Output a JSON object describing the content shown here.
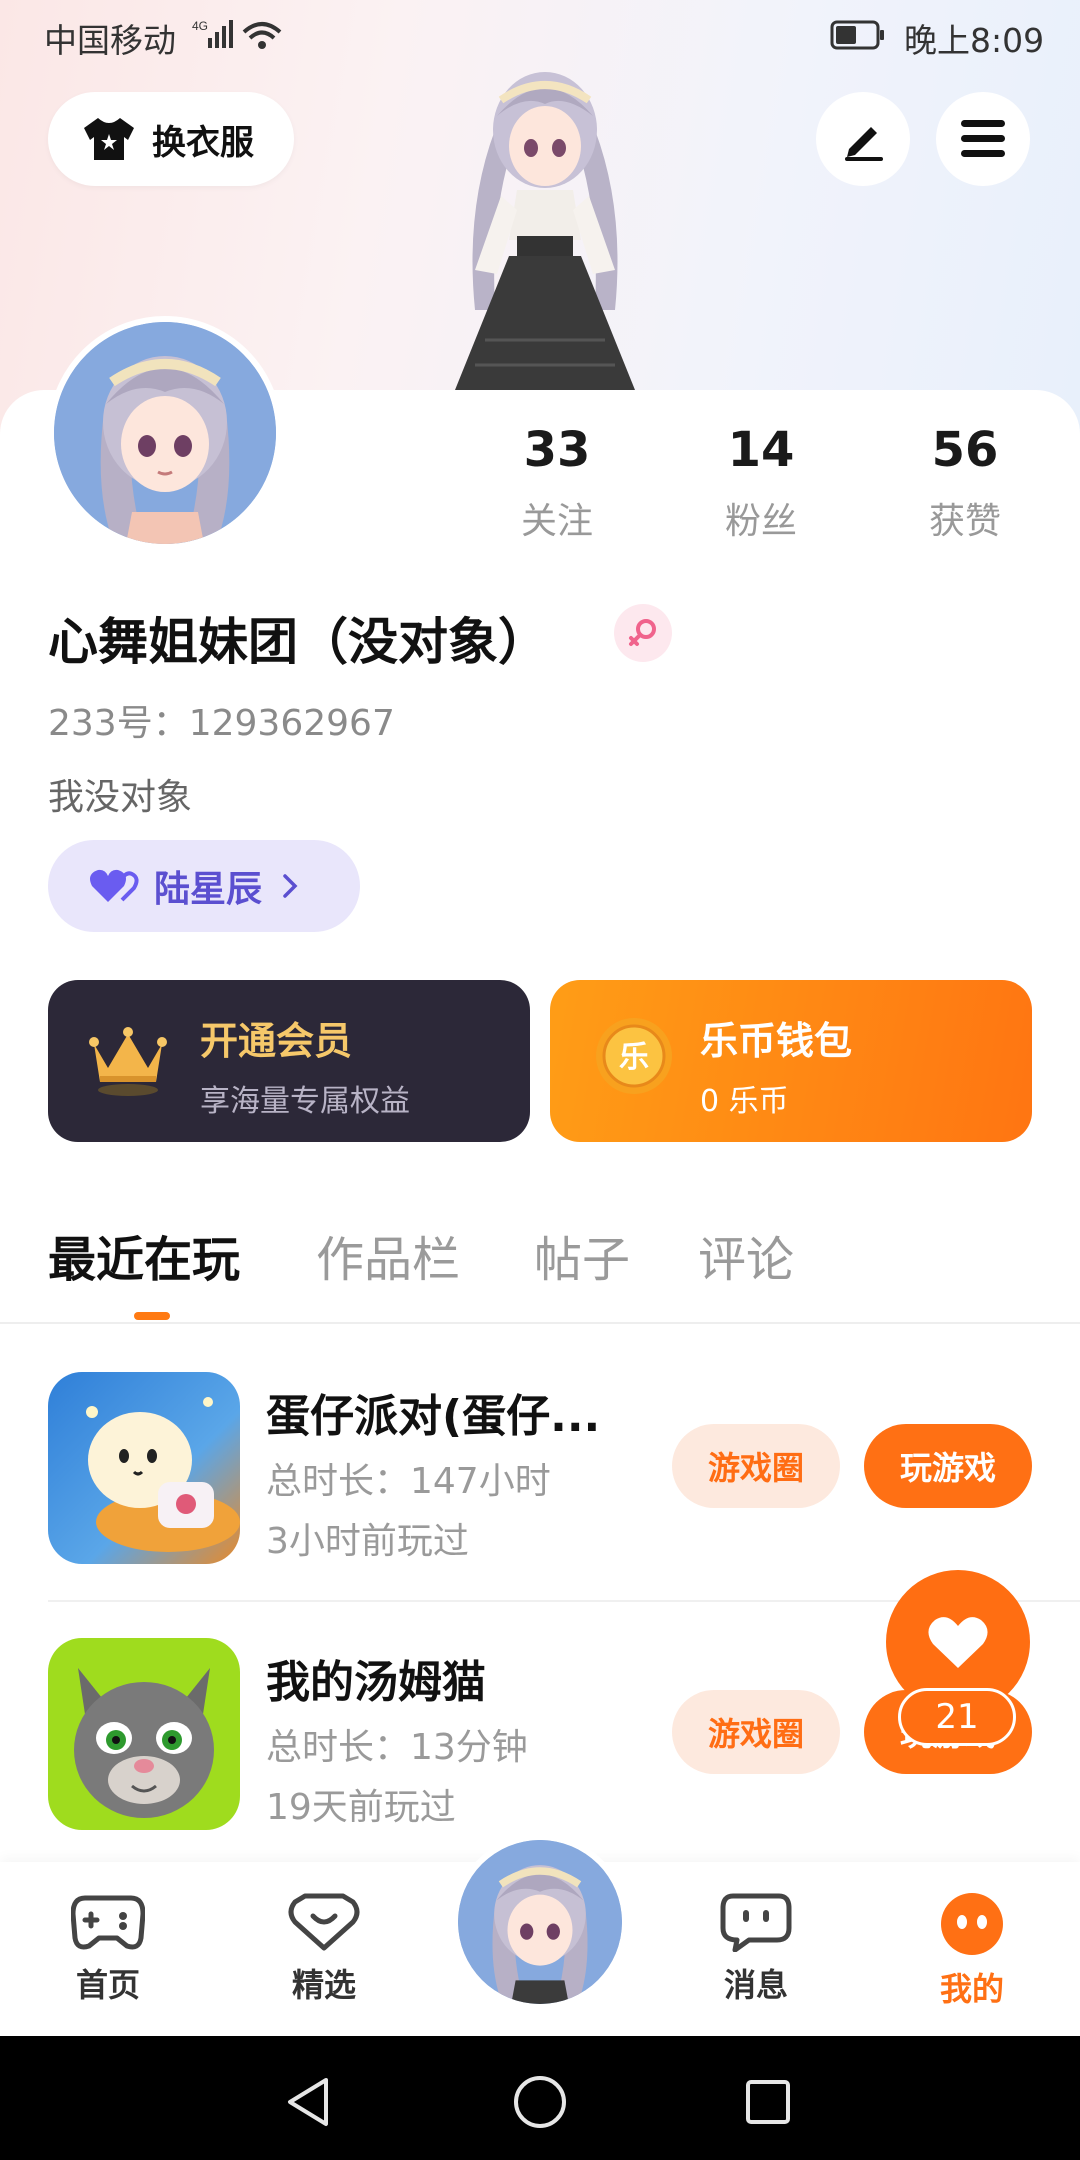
{
  "status_bar": {
    "carrier": "中国移动",
    "network": "4G",
    "time": "晚上8:09"
  },
  "top_bar": {
    "dress_label": "换衣服"
  },
  "profile": {
    "stats": [
      {
        "num": "33",
        "label": "关注"
      },
      {
        "num": "14",
        "label": "粉丝"
      },
      {
        "num": "56",
        "label": "获赞"
      }
    ],
    "nickname": "心舞姐妹团（没对象）",
    "uid": "233号：129362967",
    "bio": "我没对象",
    "cp_name": "陆星辰"
  },
  "cards": {
    "vip": {
      "title": "开通会员",
      "subtitle": "享海量专属权益"
    },
    "wallet": {
      "title": "乐币钱包",
      "subtitle": "0 乐币",
      "coin_char": "乐"
    }
  },
  "tabs": [
    "最近在玩",
    "作品栏",
    "帖子",
    "评论"
  ],
  "games": [
    {
      "title": "蛋仔派对(蛋仔...",
      "duration": "总时长：147小时",
      "last_played": "3小时前玩过",
      "circle_label": "游戏圈",
      "play_label": "玩游戏"
    },
    {
      "title": "我的汤姆猫",
      "duration": "总时长：13分钟",
      "last_played": "19天前玩过",
      "circle_label": "游戏圈",
      "play_label": "玩游戏"
    }
  ],
  "like_fab": {
    "count": "21"
  },
  "bottom_nav": [
    "首页",
    "精选",
    "消息",
    "我的"
  ],
  "colors": {
    "accent": "#ff7014",
    "vip_bg": "#2c2838",
    "vip_gold": "#f6c86a",
    "cp_purple": "#5b4fd0"
  }
}
